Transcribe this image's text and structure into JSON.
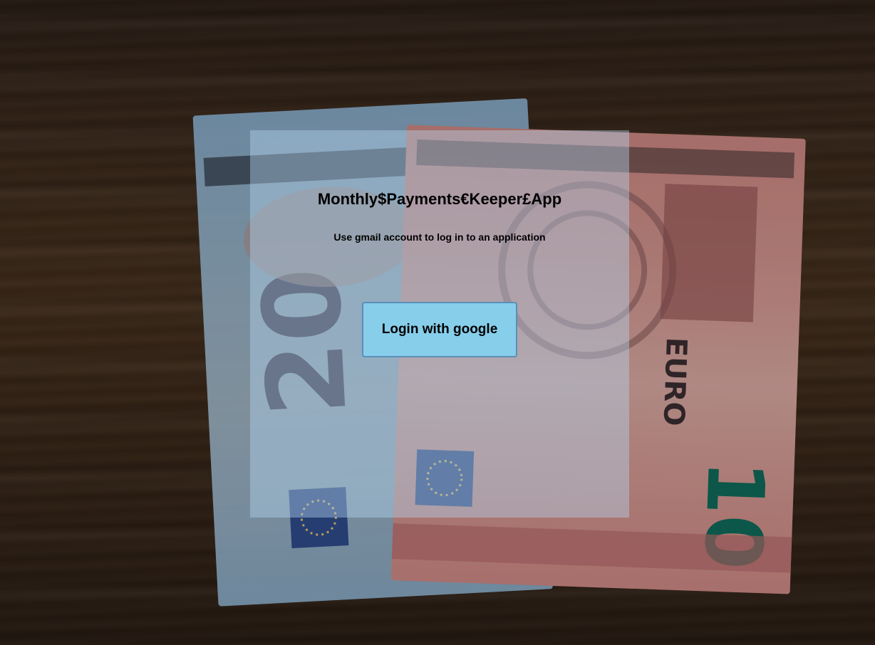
{
  "app": {
    "title": "Monthly$Payments€Keeper£App",
    "subtitle": "Use gmail account to log in to an application"
  },
  "login": {
    "button_label": "Login with google"
  },
  "background": {
    "description_icon": "euro-banknotes-photo",
    "colors": {
      "wood": "#3d2a1c",
      "note_blue": "#8fb6d6",
      "note_red": "#c46a66",
      "panel_tint": "#b4d7f0",
      "button": "#87ceeb"
    }
  }
}
